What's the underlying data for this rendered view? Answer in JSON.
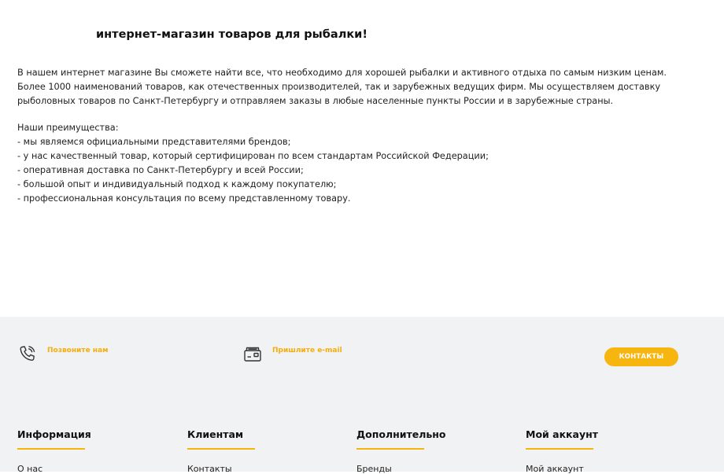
{
  "hero": {
    "title": "интернет-магазин товаров для рыбалки!"
  },
  "intro": {
    "text": "В нашем интернет магазине Вы сможете найти все, что необходимо для хорошей рыбалки и активного отдыха по самым низким ценам. Более 1000 наименований товаров, как отечественных производителей, так и зарубежных ведущих фирм. Мы осуществляем доставку рыболовных товаров по Санкт-Петербургу и отправляем заказы в любые населенные пункты России и в зарубежные страны."
  },
  "advantages": {
    "heading": "Наши преимущества:",
    "items": [
      "- мы являемся официальными представителями брендов;",
      "- у нас качественный товар, который сертифицирован по всем стандартам Российской Федерации;",
      "- оперативная доставка по Санкт-Петербургу и всей России;",
      "- большой опыт и индивидуальный подход к каждому покупателю;",
      "- профессиональная консультация по всему представленному товару."
    ]
  },
  "footer": {
    "call_label": "Позвоните нам",
    "mail_label": "Пришлите e-mail",
    "contacts_button": "Контакты",
    "columns": [
      {
        "title": "Информация",
        "first_link": "О нас"
      },
      {
        "title": "Клиентам",
        "first_link": "Контакты"
      },
      {
        "title": "Дополнительно",
        "first_link": "Бренды"
      },
      {
        "title": "Мой аккаунт",
        "first_link": "Мой аккаунт"
      }
    ]
  },
  "icons": {
    "phone": "phone-icon",
    "mail": "mail-icon"
  },
  "colors": {
    "accent": "#f7b50f",
    "footer_bg": "#f1f2f4",
    "text": "#222222"
  }
}
